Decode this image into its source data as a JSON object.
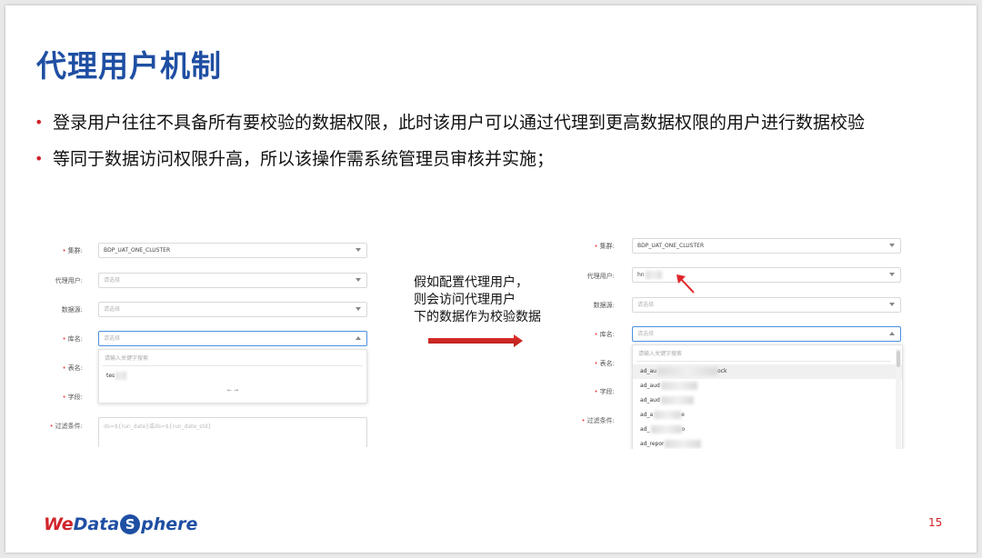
{
  "title": "代理用户机制",
  "bullets": [
    "登录用户往往不具备所有要校验的数据权限，此时该用户可以通过代理到更高数据权限的用户进行数据校验",
    "等同于数据访问权限升高，所以该操作需系统管理员审核并实施；"
  ],
  "middle_caption": [
    "假如配置代理用户，",
    "则会访问代理用户",
    "下的数据作为校验数据"
  ],
  "colors": {
    "title": "#1f4fa3",
    "accent": "#d0242b",
    "focus": "#4a90e2"
  },
  "left_form": {
    "cluster_label": "集群:",
    "cluster_value": "BDP_UAT_ONE_CLUSTER",
    "proxy_label": "代理用户:",
    "proxy_placeholder": "请选择",
    "datasource_label": "数据源:",
    "datasource_placeholder": "请选择",
    "db_label": "库名:",
    "db_placeholder": "请选择",
    "table_label": "表名:",
    "field_label": "字段:",
    "filter_label": "过滤条件:",
    "filter_value": "ds=${run_date}或ds=${run_date_std}",
    "dropdown": {
      "search_placeholder": "请输入关键字搜索",
      "item": "tes",
      "pager": "←    →"
    }
  },
  "right_form": {
    "cluster_label": "集群:",
    "cluster_value": "BDP_UAT_ONE_CLUSTER",
    "proxy_label": "代理用户:",
    "proxy_value": "hn",
    "datasource_label": "数据源:",
    "datasource_placeholder": "请选择",
    "db_label": "库名:",
    "db_placeholder": "请选择",
    "table_label": "表名:",
    "field_label": "字段:",
    "filter_label": "过滤条件:",
    "dropdown": {
      "search_placeholder": "请输入关键字搜索",
      "items": [
        "ad_au",
        "ad_aud",
        "ad_aud",
        "ad_a",
        "ad_",
        "ad_repor"
      ],
      "item_suffixes": [
        "ock",
        "",
        "",
        "e",
        "o",
        ""
      ]
    }
  },
  "logo": {
    "part1": "We",
    "part2": "Data",
    "s": "S",
    "part3": "phere"
  },
  "page_number": "15"
}
